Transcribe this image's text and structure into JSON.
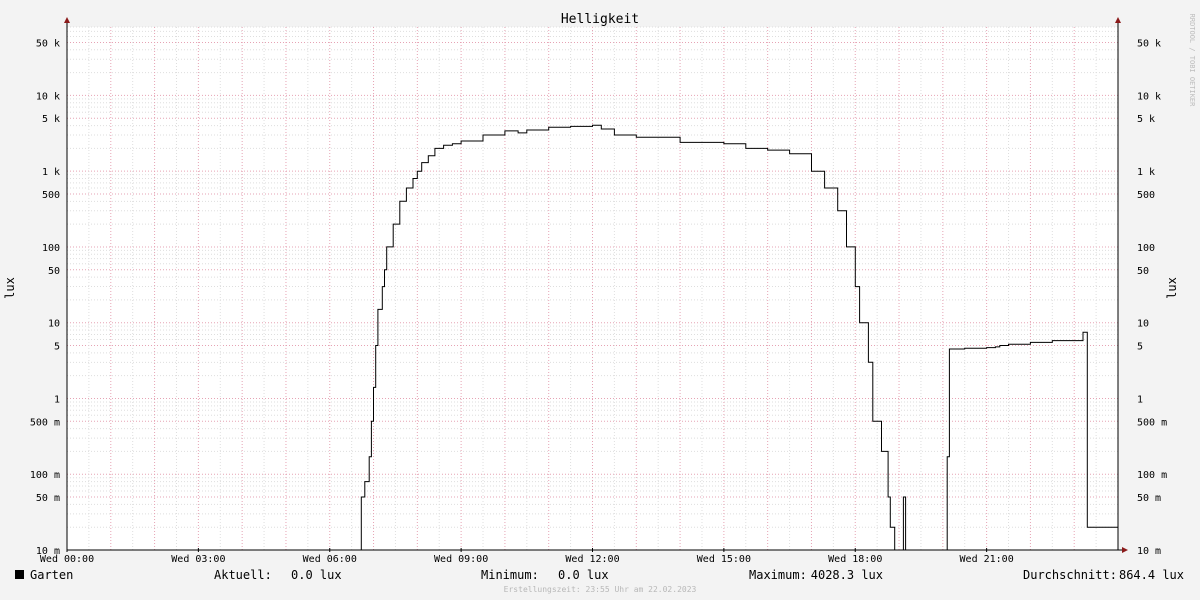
{
  "watermark": "RRDTOOL / TOBI OETIKER",
  "footer": "Erstellungszeit: 23:55 Uhr am 22.02.2023",
  "colors": {
    "background": "#f3f3f3",
    "canvas": "#ffffff",
    "minor_grid": "#dedede",
    "major_grid": "#e6a3b4",
    "series": "#000000",
    "arrow": "#8b1a1a"
  },
  "legend": {
    "series_name": "Garten",
    "current_label": "Aktuell:",
    "current_value": "0.0 lux",
    "min_label": "Minimum:",
    "min_value": "0.0 lux",
    "max_label": "Maximum:",
    "max_value": "4028.3 lux",
    "avg_label": "Durchschnitt:",
    "avg_value": "864.4 lux"
  },
  "chart_data": {
    "type": "line",
    "title": "Helligkeit",
    "ylabel": "lux",
    "y_scale": "log",
    "ylim": [
      0.01,
      80000
    ],
    "xlim": [
      0,
      24
    ],
    "x_tick_values": [
      0,
      3,
      6,
      9,
      12,
      15,
      18,
      21
    ],
    "x_tick_labels": [
      "Wed 00:00",
      "Wed 03:00",
      "Wed 06:00",
      "Wed 09:00",
      "Wed 12:00",
      "Wed 15:00",
      "Wed 18:00",
      "Wed 21:00"
    ],
    "y_tick_values": [
      0.01,
      0.05,
      0.1,
      0.5,
      1,
      5,
      10,
      50,
      100,
      500,
      1000,
      5000,
      10000,
      50000
    ],
    "y_tick_labels": [
      "10 m",
      "50 m",
      "100 m",
      "500 m",
      "1",
      "5",
      "10",
      "50",
      "100",
      "500",
      "1 k",
      "5 k",
      "10 k",
      "50 k"
    ],
    "grid": true,
    "series": [
      {
        "name": "Garten",
        "x": [
          0,
          6.7,
          6.72,
          6.8,
          6.9,
          6.95,
          7.0,
          7.05,
          7.1,
          7.2,
          7.25,
          7.3,
          7.45,
          7.6,
          7.75,
          7.9,
          8.0,
          8.1,
          8.25,
          8.4,
          8.6,
          8.8,
          9.0,
          9.5,
          10.0,
          10.3,
          10.5,
          11.0,
          11.5,
          12.0,
          12.2,
          12.5,
          13.0,
          14.0,
          15.0,
          15.5,
          16.0,
          16.5,
          17.0,
          17.3,
          17.6,
          17.8,
          18.0,
          18.1,
          18.3,
          18.4,
          18.6,
          18.75,
          18.8,
          18.9,
          18.95,
          19.05,
          19.1,
          19.15,
          19.2,
          19.3,
          19.35,
          19.4,
          19.45,
          19.5,
          19.7,
          20.05,
          20.1,
          20.15,
          20.5,
          20.8,
          21.0,
          21.2,
          21.3,
          21.5,
          22.0,
          22.5,
          23.15,
          23.2,
          23.25,
          23.3,
          24
        ],
        "y": [
          0.01,
          0.01,
          0.05,
          0.08,
          0.17,
          0.5,
          1.4,
          5,
          15,
          30,
          50,
          100,
          200,
          400,
          600,
          800,
          1000,
          1300,
          1600,
          2000,
          2200,
          2300,
          2500,
          3000,
          3400,
          3200,
          3500,
          3800,
          3900,
          4028,
          3600,
          3000,
          2800,
          2400,
          2300,
          2000,
          1900,
          1700,
          1000,
          600,
          300,
          100,
          30,
          10,
          3,
          0.5,
          0.2,
          0.05,
          0.02,
          0.01,
          0.01,
          0.01,
          0.05,
          0.01,
          0.01,
          0.01,
          0.01,
          0.01,
          0.01,
          0.01,
          0.01,
          0.01,
          0.17,
          4.5,
          4.6,
          4.6,
          4.7,
          4.8,
          5.0,
          5.2,
          5.5,
          5.8,
          5.8,
          7.5,
          7.5,
          0.02,
          0.01
        ]
      }
    ]
  }
}
